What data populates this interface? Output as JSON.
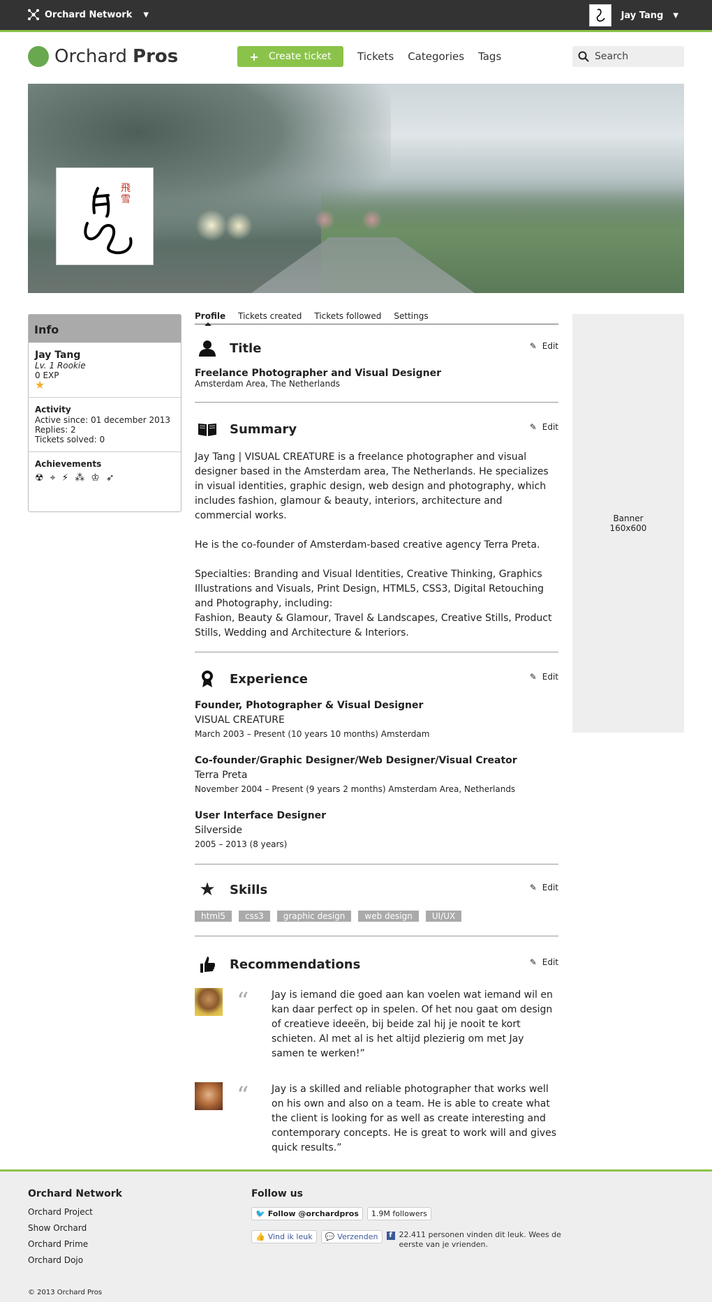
{
  "netbar": {
    "brand": "Orchard Network",
    "user": "Jay Tang"
  },
  "header": {
    "logo_light": "Orchard",
    "logo_bold": "Pros",
    "create": "Create ticket",
    "nav": [
      "Tickets",
      "Categories",
      "Tags"
    ],
    "search_placeholder": "Search"
  },
  "info": {
    "title": "Info",
    "name": "Jay Tang",
    "level": "Lv. 1 Rookie",
    "exp": "0 EXP",
    "activity_title": "Activity",
    "active_since": "Active since: 01 december 2013",
    "replies": "Replies: 2",
    "tickets_solved": "Tickets solved: 0",
    "achievements_title": "Achievements"
  },
  "tabs": [
    "Profile",
    "Tickets created",
    "Tickets followed",
    "Settings"
  ],
  "edit_label": "Edit",
  "title_section": {
    "heading": "Title",
    "role": "Freelance Photographer and Visual Designer",
    "location": "Amsterdam Area, The Netherlands"
  },
  "summary": {
    "heading": "Summary",
    "p1": "Jay Tang | VISUAL CREATURE is a freelance photographer and visual designer based in the Amsterdam area, The Netherlands. He specializes in visual identities, graphic design, web design and photography, which includes fashion, glamour & beauty, interiors, architecture and commercial works.",
    "p2": "He is the co-founder of Amsterdam-based creative agency Terra Preta.",
    "p3": "Specialties: Branding and Visual Identities, Creative Thinking, Graphics Illustrations and Visuals, Print Design, HTML5, CSS3, Digital Retouching and Photography, including:",
    "p4": "Fashion, Beauty & Glamour, Travel & Landscapes, Creative Stills, Product Stills, Wedding and Architecture & Interiors."
  },
  "experience": {
    "heading": "Experience",
    "items": [
      {
        "role": "Founder, Photographer & Visual Designer",
        "company": "VISUAL CREATURE",
        "period": "March 2003 – Present (10 years 10 months) Amsterdam"
      },
      {
        "role": "Co-founder/Graphic Designer/Web Designer/Visual Creator",
        "company": "Terra Preta",
        "period": "November 2004 – Present (9 years 2 months) Amsterdam Area, Netherlands"
      },
      {
        "role": "User Interface Designer",
        "company": "Silverside",
        "period": "2005 – 2013 (8 years)"
      }
    ]
  },
  "skills": {
    "heading": "Skills",
    "tags": [
      "html5",
      "css3",
      "graphic design",
      "web design",
      "UI/UX"
    ]
  },
  "recommendations": {
    "heading": "Recommendations",
    "items": [
      {
        "text": "Jay is iemand die goed aan kan voelen wat iemand wil en kan daar perfect op in spelen. Of het nou gaat om design of creatieve ideeën, bij beide zal hij je nooit te kort schieten. Al met al is het altijd plezierig om met Jay samen te werken!”"
      },
      {
        "text": "Jay is a skilled and reliable photographer that works well on his own and also on a team. He is able to create what the client is looking for as well as create interesting and contemporary concepts. He is great to work will and gives quick results.”"
      }
    ]
  },
  "ad": {
    "line1": "Banner",
    "line2": "160x600"
  },
  "footer": {
    "network_title": "Orchard Network",
    "links": [
      "Orchard Project",
      "Show Orchard",
      "Orchard Prime",
      "Orchard Dojo"
    ],
    "follow_title": "Follow us",
    "twitter": "Follow @orchardpros",
    "followers": "1.9M followers",
    "like": "Vind ik leuk",
    "send": "Verzenden",
    "fb_text": "22.411 personen vinden dit leuk. Wees de eerste van je vrienden.",
    "copyright": "© 2013 Orchard Pros"
  }
}
